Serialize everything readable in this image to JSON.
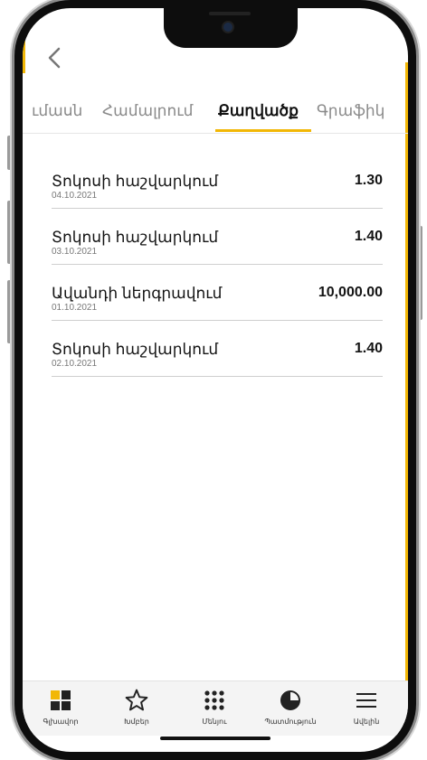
{
  "tabs": [
    {
      "label": "ւմասն",
      "active": false
    },
    {
      "label": "Համալրում",
      "active": false
    },
    {
      "label": "Քաղվածք",
      "active": true
    },
    {
      "label": "Գրաֆիկ",
      "active": false
    }
  ],
  "transactions": [
    {
      "title": "Տոկոսի հաշվարկում",
      "date": "04.10.2021",
      "amount": "1.30"
    },
    {
      "title": "Տոկոսի հաշվարկում",
      "date": "03.10.2021",
      "amount": "1.40"
    },
    {
      "title": "Ավանդի ներգրավում",
      "date": "01.10.2021",
      "amount": "10,000.00"
    },
    {
      "title": "Տոկոսի հաշվարկում",
      "date": "02.10.2021",
      "amount": "1.40"
    }
  ],
  "bottom_nav": [
    {
      "label": "Գլխավոր",
      "icon": "dashboard-grid-icon",
      "active": true
    },
    {
      "label": "Խմբեր",
      "icon": "star-icon",
      "active": false
    },
    {
      "label": "Մենյու",
      "icon": "dots-grid-icon",
      "active": false
    },
    {
      "label": "Պատմություն",
      "icon": "history-pie-icon",
      "active": false
    },
    {
      "label": "Ավելին",
      "icon": "hamburger-menu-icon",
      "active": false
    }
  ],
  "colors": {
    "accent": "#f2b705",
    "text": "#141414",
    "muted": "#8a8a8a"
  },
  "icons": {
    "back": "chevron-left-icon"
  }
}
